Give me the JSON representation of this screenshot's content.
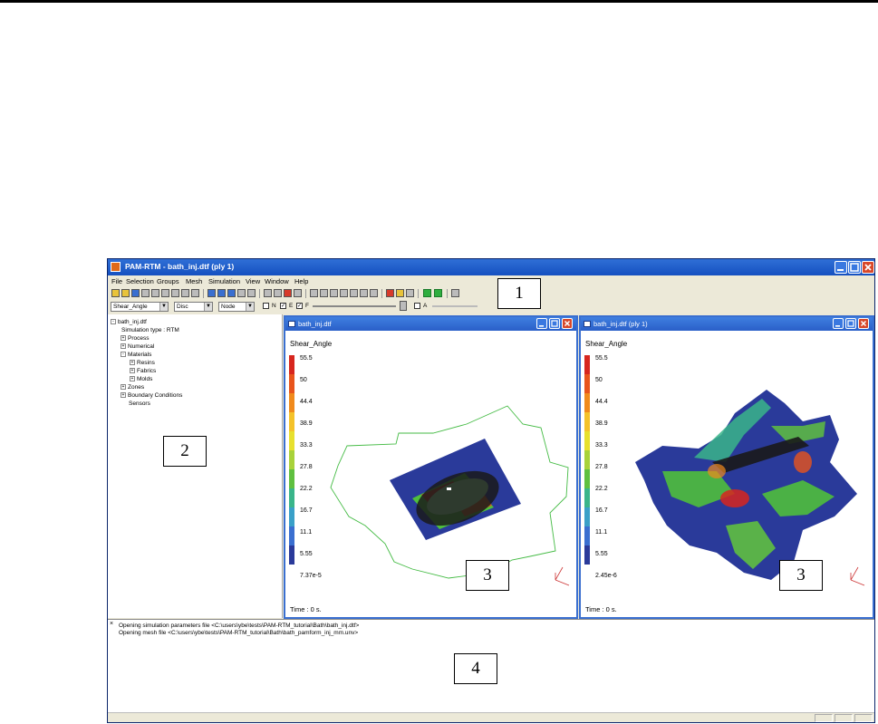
{
  "app": {
    "title": "PAM-RTM - bath_inj.dtf (ply 1)"
  },
  "menu": [
    "File",
    "Selection",
    "Groups",
    "Mesh",
    "Simulation",
    "View",
    "Window",
    "Help"
  ],
  "toolbar2": {
    "field_combo": "Shear_Angle",
    "mode_combo": "Disc",
    "location_combo": "Node",
    "checks": [
      {
        "label": "N",
        "checked": false
      },
      {
        "label": "E",
        "checked": true
      },
      {
        "label": "F",
        "checked": true
      },
      {
        "label": "A",
        "checked": false
      }
    ]
  },
  "tree": {
    "root": "bath_inj.dtf",
    "items": [
      {
        "label": "Simulation type : RTM",
        "level": 1,
        "expander": ""
      },
      {
        "label": "Process",
        "level": 1,
        "expander": "+"
      },
      {
        "label": "Numerical",
        "level": 1,
        "expander": "+"
      },
      {
        "label": "Materials",
        "level": 1,
        "expander": "-"
      },
      {
        "label": "Resins",
        "level": 2,
        "expander": "+"
      },
      {
        "label": "Fabrics",
        "level": 2,
        "expander": "+"
      },
      {
        "label": "Molds",
        "level": 2,
        "expander": "+"
      },
      {
        "label": "Zones",
        "level": 1,
        "expander": "+"
      },
      {
        "label": "Boundary Conditions",
        "level": 1,
        "expander": "+"
      },
      {
        "label": "Sensors",
        "level": 1,
        "expander": ""
      }
    ]
  },
  "views": [
    {
      "title": "bath_inj.dtf",
      "field": "Shear_Angle",
      "legend": [
        "55.5",
        "50",
        "44.4",
        "38.9",
        "33.3",
        "27.8",
        "22.2",
        "16.7",
        "11.1",
        "5.55",
        "7.37e-5"
      ],
      "time": "Time : 0 s."
    },
    {
      "title": "bath_inj.dtf (ply 1)",
      "field": "Shear_Angle",
      "legend": [
        "55.5",
        "50",
        "44.4",
        "38.9",
        "33.3",
        "27.8",
        "22.2",
        "16.7",
        "11.1",
        "5.55",
        "2.45e-6"
      ],
      "time": "Time : 0 s."
    }
  ],
  "legend_colors": [
    "#d7261e",
    "#e8541c",
    "#f08a1c",
    "#f4c22a",
    "#e7e02e",
    "#a8d23a",
    "#5fc040",
    "#3ab58a",
    "#3aa0c8",
    "#3a6fd0",
    "#2a3a9a"
  ],
  "log": [
    "Opening simulation parameters file <C:\\users\\ybe\\tests\\PAM-RTM_tutorial\\Bath\\bath_inj.dtf>",
    "Opening mesh file <C:\\users\\ybe\\tests\\PAM-RTM_tutorial\\Bath\\bath_pamform_inj_mm.unv>"
  ],
  "callouts": [
    "1",
    "2",
    "3",
    "3",
    "4"
  ]
}
